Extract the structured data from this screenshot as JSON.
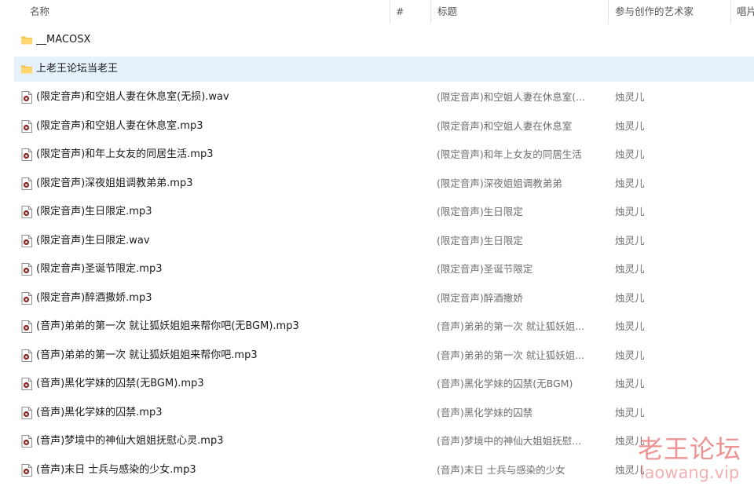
{
  "columns": {
    "name": "名称",
    "number": "#",
    "title": "标题",
    "artist": "参与创作的艺术家",
    "album": "唱片"
  },
  "rows": [
    {
      "type": "folder",
      "name": "__MACOSX",
      "title": "",
      "artist": "",
      "selected": false
    },
    {
      "type": "folder",
      "name": "上老王论坛当老王",
      "title": "",
      "artist": "",
      "selected": true
    },
    {
      "type": "audio",
      "name": "(限定音声)和空姐人妻在休息室(无损).wav",
      "title": "(限定音声)和空姐人妻在休息室(...",
      "artist": "烛灵儿",
      "selected": false
    },
    {
      "type": "audio",
      "name": "(限定音声)和空姐人妻在休息室.mp3",
      "title": "(限定音声)和空姐人妻在休息室",
      "artist": "烛灵儿",
      "selected": false
    },
    {
      "type": "audio",
      "name": "(限定音声)和年上女友的同居生活.mp3",
      "title": "(限定音声)和年上女友的同居生活",
      "artist": "烛灵儿",
      "selected": false
    },
    {
      "type": "audio",
      "name": "(限定音声)深夜姐姐调教弟弟.mp3",
      "title": "(限定音声)深夜姐姐调教弟弟",
      "artist": "烛灵儿",
      "selected": false
    },
    {
      "type": "audio",
      "name": "(限定音声)生日限定.mp3",
      "title": "(限定音声)生日限定",
      "artist": "烛灵儿",
      "selected": false
    },
    {
      "type": "audio",
      "name": "(限定音声)生日限定.wav",
      "title": "(限定音声)生日限定",
      "artist": "烛灵儿",
      "selected": false
    },
    {
      "type": "audio",
      "name": "(限定音声)圣诞节限定.mp3",
      "title": "(限定音声)圣诞节限定",
      "artist": "烛灵儿",
      "selected": false
    },
    {
      "type": "audio",
      "name": "(限定音声)醉酒撒娇.mp3",
      "title": "(限定音声)醉酒撒娇",
      "artist": "烛灵儿",
      "selected": false
    },
    {
      "type": "audio",
      "name": "(音声)弟弟的第一次 就让狐妖姐姐来帮你吧(无BGM).mp3",
      "title": "(音声)弟弟的第一次 就让狐妖姐...",
      "artist": "烛灵儿",
      "selected": false
    },
    {
      "type": "audio",
      "name": "(音声)弟弟的第一次 就让狐妖姐姐来帮你吧.mp3",
      "title": "(音声)弟弟的第一次 就让狐妖姐...",
      "artist": "烛灵儿",
      "selected": false
    },
    {
      "type": "audio",
      "name": "(音声)黑化学妹的囚禁(无BGM).mp3",
      "title": "(音声)黑化学妹的囚禁(无BGM)",
      "artist": "烛灵儿",
      "selected": false
    },
    {
      "type": "audio",
      "name": "(音声)黑化学妹的囚禁.mp3",
      "title": "(音声)黑化学妹的囚禁",
      "artist": "烛灵儿",
      "selected": false
    },
    {
      "type": "audio",
      "name": "(音声)梦境中的神仙大姐姐抚慰心灵.mp3",
      "title": "(音声)梦境中的神仙大姐姐抚慰...",
      "artist": "烛灵儿",
      "selected": false
    },
    {
      "type": "audio",
      "name": "(音声)末日 士兵与感染的少女.mp3",
      "title": "(音声)末日 士兵与感染的少女",
      "artist": "烛灵儿",
      "selected": false
    }
  ],
  "watermark": {
    "title": "老王论坛",
    "url": "laowang.vip"
  },
  "icons": {
    "folder": "folder-icon",
    "audio": "audio-file-icon",
    "sort": "sort-ascending-icon"
  },
  "colors": {
    "selection": "#e5f1fb",
    "folder": "#f5c14a",
    "audio_badge": "#8a2a2a",
    "watermark": "#e25050"
  }
}
